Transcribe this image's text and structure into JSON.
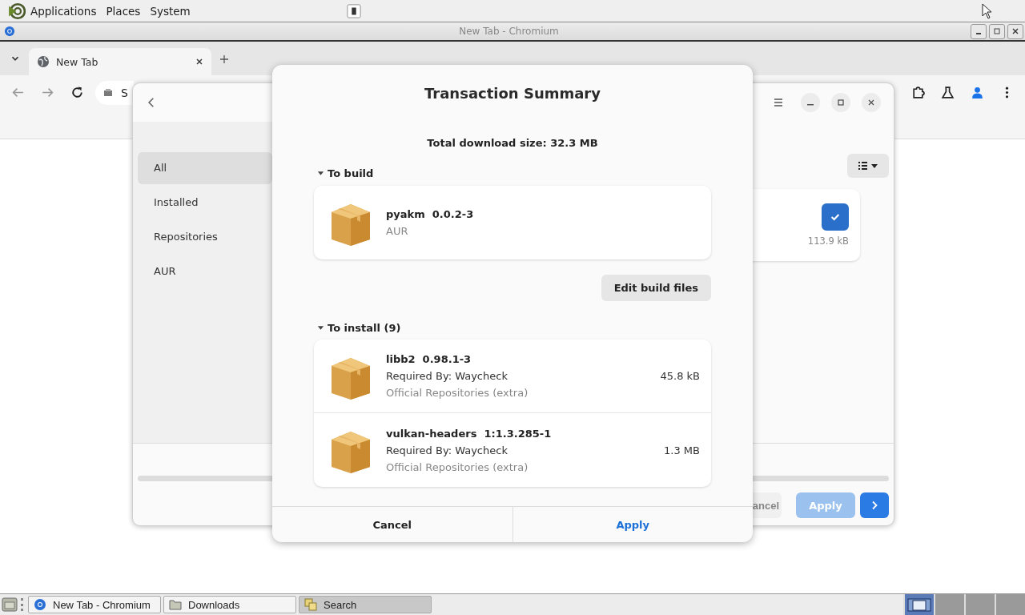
{
  "top_panel": {
    "menus": [
      "Applications",
      "Places",
      "System"
    ]
  },
  "browser": {
    "title": "New Tab - Chromium",
    "tabs": [
      {
        "label": "New Tab",
        "selected": true
      }
    ],
    "omnibox": {
      "value": "S"
    }
  },
  "app": {
    "sidebar": [
      {
        "label": "All",
        "selected": true
      },
      {
        "label": "Installed",
        "selected": false
      },
      {
        "label": "Repositories",
        "selected": false
      },
      {
        "label": "AUR",
        "selected": false
      }
    ],
    "package_card": {
      "checked": true,
      "size": "113.9 kB"
    },
    "buttons": [
      {
        "label": "ancel",
        "kind": "cancel",
        "disabled": false
      },
      {
        "label": "Apply",
        "kind": "apply",
        "disabled": true
      }
    ]
  },
  "dialog": {
    "title": "Transaction Summary",
    "total": "Total download size: 32.3 MB",
    "sections": [
      {
        "title": "To build",
        "expanded": true,
        "action": "Edit build files",
        "packages": [
          {
            "name": "pyakm",
            "version": "0.0.2-3",
            "repo": "AUR"
          }
        ]
      },
      {
        "title": "To install (9)",
        "expanded": true,
        "packages": [
          {
            "name": "libb2",
            "version": "0.98.1-3",
            "required_by": "Required By: Waycheck",
            "repo": "Official Repositories (extra)",
            "size": "45.8 kB"
          },
          {
            "name": "vulkan-headers",
            "version": "1:1.3.285-1",
            "required_by": "Required By: Waycheck",
            "repo": "Official Repositories (extra)",
            "size": "1.3 MB"
          }
        ]
      }
    ],
    "buttons": [
      "Cancel",
      "Apply"
    ]
  },
  "taskbar": {
    "windows": [
      {
        "label": "New Tab - Chromium",
        "kind": "browser",
        "selected": false
      },
      {
        "label": "Downloads",
        "kind": "folder",
        "selected": false
      },
      {
        "label": "Search",
        "kind": "search",
        "selected": true
      }
    ],
    "workspaces": [
      {
        "selected": true
      },
      {
        "selected": false
      },
      {
        "selected": false
      },
      {
        "selected": false
      }
    ]
  }
}
